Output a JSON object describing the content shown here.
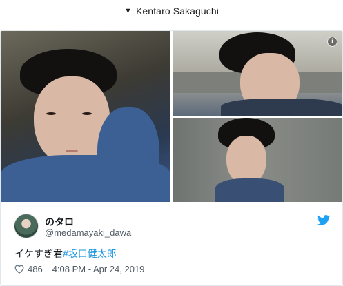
{
  "header": {
    "arrow": "▼",
    "title": "Kentaro Sakaguchi"
  },
  "media": {
    "info_icon": "i",
    "images": [
      {
        "name": "photo-main",
        "icon": "photo"
      },
      {
        "name": "photo-top-right",
        "icon": "photo"
      },
      {
        "name": "photo-bottom-right",
        "icon": "photo"
      }
    ]
  },
  "tweet": {
    "display_name": "のタロ",
    "handle": "@medamayaki_dawa",
    "text_prefix": "イケすぎ君",
    "hashtag": "#坂口健太郎",
    "likes": "486",
    "timestamp": "4:08 PM - Apr 24, 2019"
  },
  "icons": {
    "brand": "twitter-bird-icon",
    "like": "heart-icon",
    "info": "info-icon"
  },
  "colors": {
    "brand_blue": "#1da1f2",
    "hashtag": "#1b95e0",
    "secondary_text": "#4f5a64",
    "border": "#e1e8ed"
  }
}
